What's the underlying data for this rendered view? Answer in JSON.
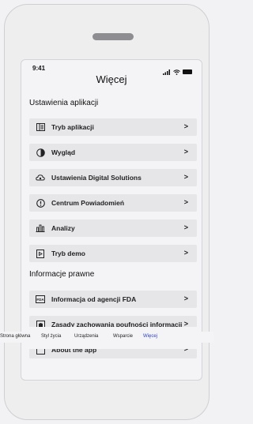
{
  "status": {
    "time": "9:41",
    "signal_icon": "signal-icon",
    "wifi_icon": "wifi-icon",
    "battery_icon": "battery-icon"
  },
  "page": {
    "title": "Więcej"
  },
  "sections": {
    "app_settings": "Ustawienia aplikacji",
    "legal": "Informacje prawne"
  },
  "items": [
    {
      "label": "Tryb aplikacji",
      "icon": "app-mode-icon"
    },
    {
      "label": "Wygląd",
      "icon": "appearance-icon"
    },
    {
      "label": "Ustawienia Digital Solutions",
      "icon": "cloud-settings-icon"
    },
    {
      "label": "Centrum Powiadomień",
      "icon": "notification-icon"
    },
    {
      "label": "Analizy",
      "icon": "analytics-icon"
    },
    {
      "label": "Tryb demo",
      "icon": "demo-icon"
    },
    {
      "label": "Informacja od agencji FDA",
      "icon": "fda-icon"
    },
    {
      "label": "Zasady zachowania poufności informacji",
      "icon": "privacy-icon"
    },
    {
      "label": "About the app",
      "icon": "about-icon"
    }
  ],
  "chevron": ">",
  "tabs": [
    {
      "label": "Strona główna",
      "icon": "home-grid-icon"
    },
    {
      "label": "Styl życia",
      "icon": "activity-icon"
    },
    {
      "label": "Urządzenia",
      "icon": "devices-icon"
    },
    {
      "label": "Wsparcie",
      "icon": "chat-icon"
    },
    {
      "label": "Więcej",
      "icon": "gear-icon"
    }
  ],
  "colors": {
    "accent": "#2b3fbf",
    "row_bg": "#e6e6e9",
    "screen_bg": "#f4f4f6"
  }
}
